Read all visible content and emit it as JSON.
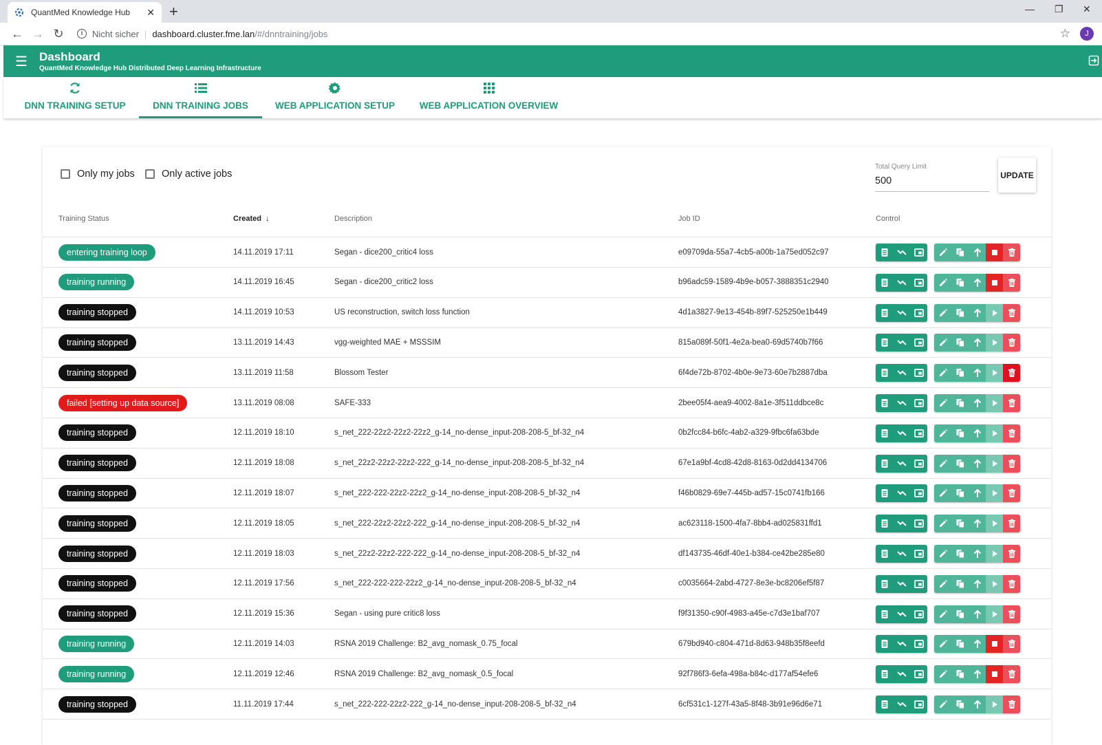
{
  "browser": {
    "tab_title": "QuantMed Knowledge Hub",
    "insecure_label": "Nicht sicher",
    "url_host": "dashboard.cluster.fme.lan",
    "url_path": "/#/dnntraining/jobs",
    "profile_initial": "J"
  },
  "header": {
    "title": "Dashboard",
    "subtitle": "QuantMed Knowledge Hub Distributed Deep Learning Infrastructure"
  },
  "nav": {
    "tabs": [
      {
        "label": "DNN TRAINING SETUP",
        "icon": "refresh-icon"
      },
      {
        "label": "DNN TRAINING JOBS",
        "icon": "list-icon",
        "active": true
      },
      {
        "label": "WEB APPLICATION SETUP",
        "icon": "gear-icon"
      },
      {
        "label": "WEB APPLICATION OVERVIEW",
        "icon": "grid-icon"
      }
    ]
  },
  "filters": {
    "only_my_jobs": "Only my jobs",
    "only_active_jobs": "Only active jobs"
  },
  "query_limit": {
    "label": "Total Query Limit",
    "value": "500"
  },
  "update_label": "UPDATE",
  "columns": {
    "status": "Training Status",
    "created": "Created",
    "description": "Description",
    "job_id": "Job ID",
    "control": "Control"
  },
  "colors": {
    "primary": "#1e9c7c",
    "status_green": "#1e9c7c",
    "status_black": "#111111",
    "status_red": "#e21a1a",
    "stop_red": "#e32424"
  },
  "jobs": [
    {
      "status": "entering training loop",
      "kind": "green",
      "created": "14.11.2019 17:11",
      "description": "Segan - dice200_critic4 loss",
      "job_id": "e09709da-55a7-4cb5-a00b-1a75ed052c97",
      "action": "stop"
    },
    {
      "status": "training running",
      "kind": "green",
      "created": "14.11.2019 16:45",
      "description": "Segan - dice200_critic2 loss",
      "job_id": "b96adc59-1589-4b9e-b057-3888351c2940",
      "action": "stop"
    },
    {
      "status": "training stopped",
      "kind": "black",
      "created": "14.11.2019 10:53",
      "description": "US reconstruction, switch loss function",
      "job_id": "4d1a3827-9e13-454b-89f7-525250e1b449",
      "action": "play"
    },
    {
      "status": "training stopped",
      "kind": "black",
      "created": "13.11.2019 14:43",
      "description": "vgg-weighted MAE + MSSSIM",
      "job_id": "815a089f-50f1-4e2a-bea0-69d5740b7f66",
      "action": "play"
    },
    {
      "status": "training stopped",
      "kind": "black",
      "created": "13.11.2019 11:58",
      "description": "Blossom Tester",
      "job_id": "6f4de72b-8702-4b0e-9e73-60e7b2887dba",
      "action": "play"
    },
    {
      "status": "failed [setting up data source]",
      "kind": "red",
      "created": "13.11.2019 08:08",
      "description": "SAFE-333",
      "job_id": "2bee05f4-aea9-4002-8a1e-3f511ddbce8c",
      "action": "play"
    },
    {
      "status": "training stopped",
      "kind": "black",
      "created": "12.11.2019 18:10",
      "description": "s_net_222-22z2-22z2-22z2_g-14_no-dense_input-208-208-5_bf-32_n4",
      "job_id": "0b2fcc84-b6fc-4ab2-a329-9fbc6fa63bde",
      "action": "play"
    },
    {
      "status": "training stopped",
      "kind": "black",
      "created": "12.11.2019 18:08",
      "description": "s_net_22z2-22z2-22z2-222_g-14_no-dense_input-208-208-5_bf-32_n4",
      "job_id": "67e1a9bf-4cd8-42d8-8163-0d2dd4134706",
      "action": "play"
    },
    {
      "status": "training stopped",
      "kind": "black",
      "created": "12.11.2019 18:07",
      "description": "s_net_222-222-22z2-22z2_g-14_no-dense_input-208-208-5_bf-32_n4",
      "job_id": "f46b0829-69e7-445b-ad57-15c0741fb166",
      "action": "play"
    },
    {
      "status": "training stopped",
      "kind": "black",
      "created": "12.11.2019 18:05",
      "description": "s_net_222-22z2-22z2-222_g-14_no-dense_input-208-208-5_bf-32_n4",
      "job_id": "ac623118-1500-4fa7-8bb4-ad025831ffd1",
      "action": "play"
    },
    {
      "status": "training stopped",
      "kind": "black",
      "created": "12.11.2019 18:03",
      "description": "s_net_22z2-22z2-222-222_g-14_no-dense_input-208-208-5_bf-32_n4",
      "job_id": "df143735-46df-40e1-b384-ce42be285e80",
      "action": "play"
    },
    {
      "status": "training stopped",
      "kind": "black",
      "created": "12.11.2019 17:56",
      "description": "s_net_222-222-222-22z2_g-14_no-dense_input-208-208-5_bf-32_n4",
      "job_id": "c0035664-2abd-4727-8e3e-bc8206ef5f87",
      "action": "play"
    },
    {
      "status": "training stopped",
      "kind": "black",
      "created": "12.11.2019 15:36",
      "description": "Segan - using pure critic8 loss",
      "job_id": "f9f31350-c90f-4983-a45e-c7d3e1baf707",
      "action": "play"
    },
    {
      "status": "training running",
      "kind": "green",
      "created": "12.11.2019 14:03",
      "description": "RSNA 2019 Challenge: B2_avg_nomask_0.75_focal",
      "job_id": "679bd940-c804-471d-8d63-948b35f8eefd",
      "action": "stop"
    },
    {
      "status": "training running",
      "kind": "green",
      "created": "12.11.2019 12:46",
      "description": "RSNA 2019 Challenge: B2_avg_nomask_0.5_focal",
      "job_id": "92f786f3-6efa-498a-b84c-d177af54efe6",
      "action": "stop"
    },
    {
      "status": "training stopped",
      "kind": "black",
      "created": "11.11.2019 17:44",
      "description": "s_net_222-222-22z2-222_g-14_no-dense_input-208-208-5_bf-32_n4",
      "job_id": "6cf531c1-127f-43a5-8f48-3b91e96d6e71",
      "action": "play"
    }
  ]
}
